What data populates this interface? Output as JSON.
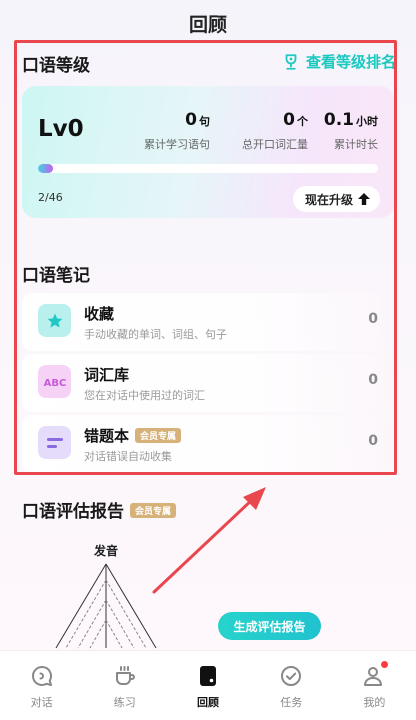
{
  "page": {
    "title": "回顾"
  },
  "speaking_level": {
    "section_title": "口语等级",
    "rank_link": "查看等级排名",
    "level": "Lv0",
    "stats": [
      {
        "value": "0",
        "unit": "句",
        "label": "累计学习语句"
      },
      {
        "value": "0",
        "unit": "个",
        "label": "总开口词汇量"
      },
      {
        "value": "0.1",
        "unit": "小时",
        "label": "累计时长"
      }
    ],
    "progress": {
      "text": "2/46",
      "fraction": 0.043
    },
    "upgrade_label": "现在升级"
  },
  "notes": {
    "section_title": "口语笔记",
    "items": [
      {
        "title": "收藏",
        "desc": "手动收藏的单词、词组、句子",
        "count": "0",
        "icon": "star-icon",
        "badge": ""
      },
      {
        "title": "词汇库",
        "desc": "您在对话中使用过的词汇",
        "count": "0",
        "icon": "abc-icon",
        "badge": ""
      },
      {
        "title": "错题本",
        "desc": "对话错误自动收集",
        "count": "0",
        "icon": "error-book-icon",
        "badge": "会员专属"
      }
    ]
  },
  "report": {
    "title": "口语评估报告",
    "badge": "会员专属",
    "radar_axis_label": "发音",
    "generate_label": "生成评估报告"
  },
  "tabbar": {
    "items": [
      {
        "label": "对话",
        "icon": "chat-icon",
        "active": false
      },
      {
        "label": "练习",
        "icon": "cup-icon",
        "active": false
      },
      {
        "label": "回顾",
        "icon": "review-icon",
        "active": true
      },
      {
        "label": "任务",
        "icon": "task-check-icon",
        "active": false
      },
      {
        "label": "我的",
        "icon": "profile-icon",
        "active": false,
        "notification_dot": true
      }
    ]
  },
  "colors": {
    "accent": "#1bc9c0",
    "highlight_border": "#e9474d",
    "vip_badge": "#d6b27a",
    "notification": "#ff3b3b"
  }
}
